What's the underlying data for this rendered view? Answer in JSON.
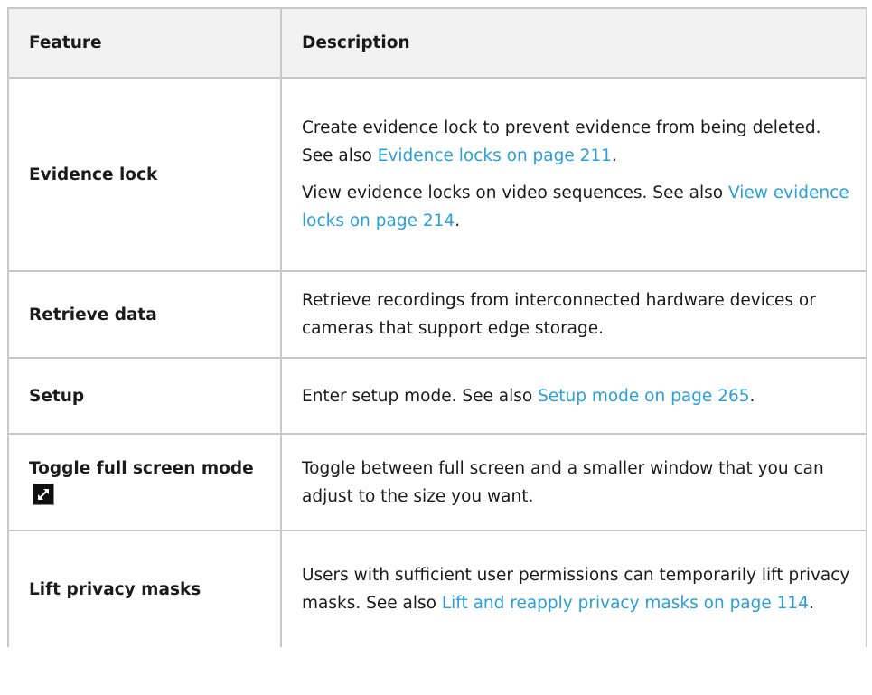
{
  "table": {
    "headers": {
      "feature": "Feature",
      "description": "Description"
    },
    "rows": [
      {
        "feature": "Evidence lock",
        "paragraphs": [
          {
            "text": "Create evidence lock to prevent evidence from being deleted. See also ",
            "link": "Evidence locks on page 211",
            "after": "."
          },
          {
            "text": "View evidence locks on video sequences. See also ",
            "link": "View evidence locks on page 214",
            "after": "."
          }
        ]
      },
      {
        "feature": "Retrieve data",
        "paragraphs": [
          {
            "text": "Retrieve recordings from interconnected hardware devices or cameras that support edge storage."
          }
        ]
      },
      {
        "feature": "Setup",
        "paragraphs": [
          {
            "text": "Enter setup mode. See also ",
            "link": "Setup mode on page 265",
            "after": "."
          }
        ]
      },
      {
        "feature": "Toggle full screen mode",
        "icon": "fullscreen-toggle-icon",
        "paragraphs": [
          {
            "text": "Toggle between full screen and a smaller window that you can adjust to the size you want."
          }
        ]
      },
      {
        "feature": "Lift privacy masks",
        "paragraphs": [
          {
            "text": "Users with sufficient user permissions can temporarily lift privacy masks. See also ",
            "link": "Lift and reapply privacy masks on page 114",
            "after": "."
          }
        ]
      }
    ]
  },
  "colors": {
    "link": "#2a9fd8",
    "header_bg": "#f2f2f2",
    "border": "#c8c8c8"
  }
}
